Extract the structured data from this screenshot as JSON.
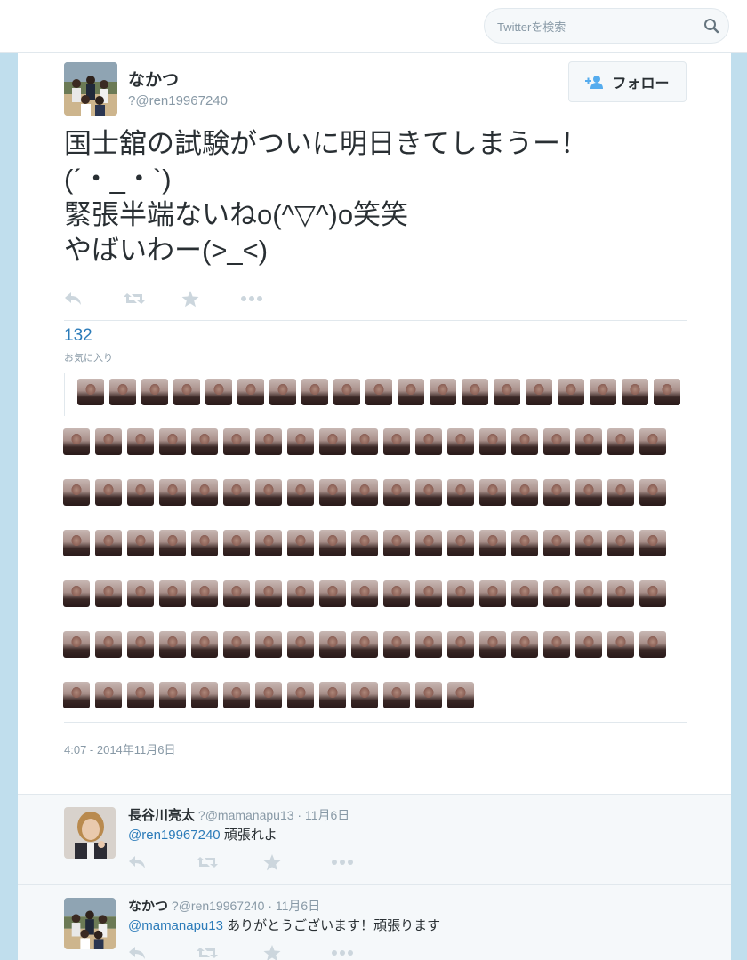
{
  "search": {
    "placeholder": "Twitterを検索"
  },
  "tweet": {
    "display_name": "なかつ",
    "screen_name": "?@ren19967240",
    "follow_label": "フォロー",
    "text_lines": [
      "国士舘の試験がついに明日きてしまうー！",
      "(´・_・`)",
      "緊張半端ないねo(^▽^)o笑笑",
      "やばいわー(>_<)"
    ],
    "favorite_count": "132",
    "favorite_label": "お気に入り",
    "favoriter_avatar_count": 127,
    "timestamp": "4:07 - 2014年11月6日",
    "icons": [
      "reply-icon",
      "retweet-icon",
      "favorite-icon",
      "more-icon",
      "follow-person-icon",
      "search-icon"
    ]
  },
  "replies": [
    {
      "name": "長谷川亮太",
      "meta": "?@mamanapu13 · 11月6日",
      "mention": "@ren19967240",
      "text": " 頑張れよ"
    },
    {
      "name": "なかつ",
      "meta": "?@ren19967240 · 11月6日",
      "mention": "@mamanapu13",
      "text": " ありがとうございます！頑張ります"
    }
  ],
  "colors": {
    "link": "#2b7bb9",
    "muted": "#8899a6",
    "background": "#c0deed",
    "text": "#292f33"
  }
}
